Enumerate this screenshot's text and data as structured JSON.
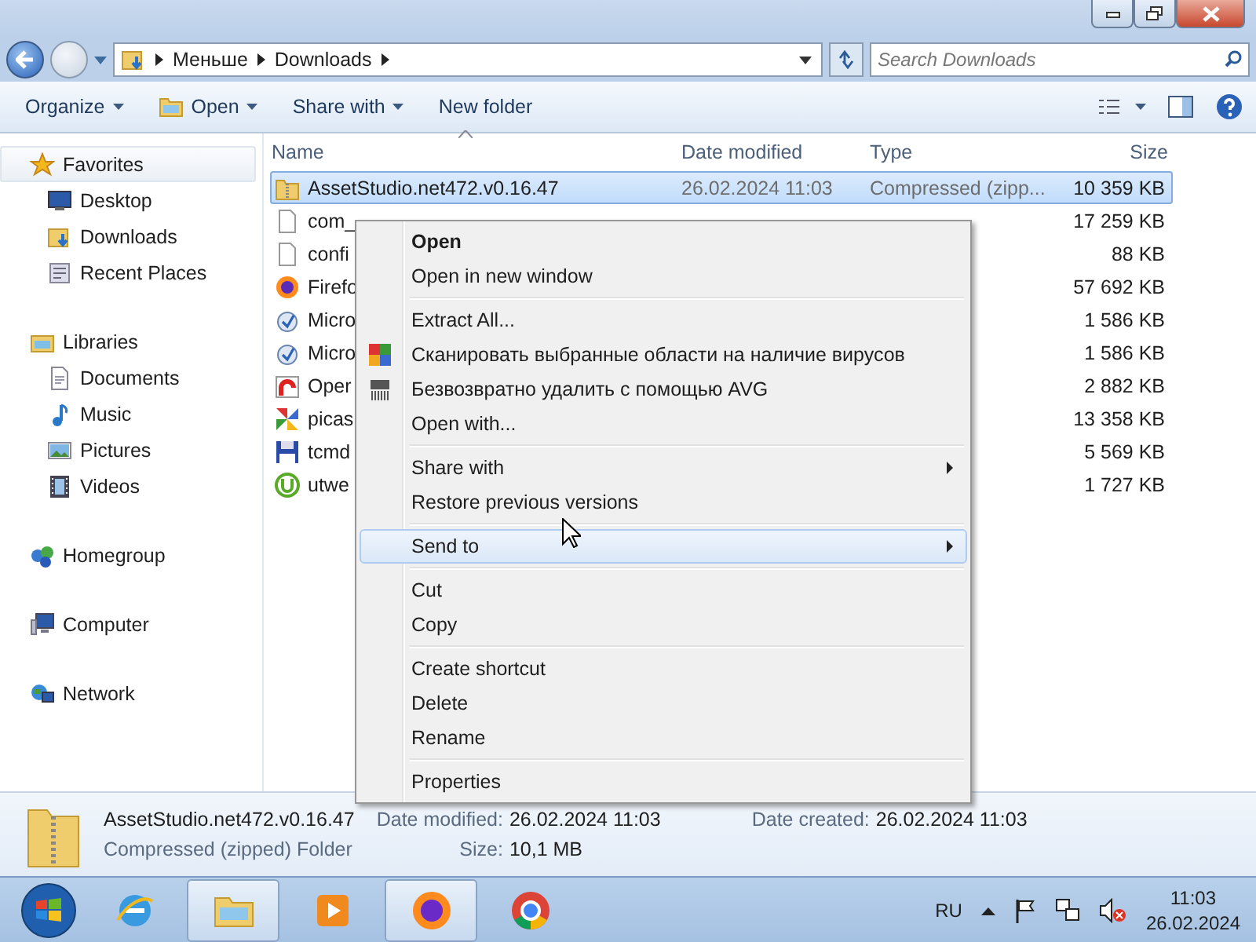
{
  "address": {
    "path": [
      "Меньше",
      "Downloads"
    ],
    "search_placeholder": "Search Downloads"
  },
  "toolbar": [
    {
      "label": "Organize",
      "dropdown": true
    },
    {
      "label": "Open",
      "dropdown": true
    },
    {
      "label": "Share with",
      "dropdown": true
    },
    {
      "label": "New folder",
      "dropdown": false
    }
  ],
  "sidebar": [
    {
      "label": "Favorites",
      "selected": true,
      "children": [
        {
          "label": "Desktop",
          "selected": false
        },
        {
          "label": "Downloads",
          "selected": false
        },
        {
          "label": "Recent Places",
          "selected": false
        }
      ]
    },
    {
      "label": "Libraries",
      "selected": false,
      "children": [
        {
          "label": "Documents",
          "selected": false
        },
        {
          "label": "Music",
          "selected": false
        },
        {
          "label": "Pictures",
          "selected": false
        },
        {
          "label": "Videos",
          "selected": false
        }
      ]
    },
    {
      "label": "Homegroup",
      "selected": false
    },
    {
      "label": "Computer",
      "selected": false
    },
    {
      "label": "Network",
      "selected": false
    }
  ],
  "columns": [
    "Name",
    "Date modified",
    "Type",
    "Size"
  ],
  "rows": [
    {
      "name": "AssetStudio.net472.v0.16.47",
      "date": "26.02.2024 11:03",
      "type": "Compressed (zipp...",
      "size": "10 359 KB",
      "selected": true
    },
    {
      "name": "com_",
      "size": "17 259 KB",
      "selected": false
    },
    {
      "name": "confi",
      "size": "88 KB",
      "selected": false
    },
    {
      "name": "Firefo",
      "size": "57 692 KB",
      "selected": false
    },
    {
      "name": "Micro",
      "size": "1 586 KB",
      "selected": false
    },
    {
      "name": "Micro",
      "size": "1 586 KB",
      "selected": false
    },
    {
      "name": "Oper",
      "size": "2 882 KB",
      "selected": false
    },
    {
      "name": "picas",
      "size": "13 358 KB",
      "selected": false
    },
    {
      "name": "tcmd",
      "size": "5 569 KB",
      "selected": false
    },
    {
      "name": "utwe",
      "size": "1 727 KB",
      "selected": false
    }
  ],
  "context_menu": [
    {
      "kind": "item",
      "label": "Open",
      "default": true,
      "selected": false
    },
    {
      "kind": "item",
      "label": "Open in new window",
      "default": false,
      "selected": false
    },
    {
      "kind": "separator"
    },
    {
      "kind": "item",
      "label": "Extract All...",
      "default": false,
      "selected": false
    },
    {
      "kind": "item",
      "label": "Сканировать выбранные области на наличие вирусов",
      "default": false,
      "selected": false
    },
    {
      "kind": "item",
      "label": "Безвозвратно удалить с помощью AVG",
      "default": false,
      "selected": false
    },
    {
      "kind": "item",
      "label": "Open with...",
      "default": false,
      "selected": false
    },
    {
      "kind": "separator"
    },
    {
      "kind": "item",
      "label": "Share with",
      "default": false,
      "selected": false,
      "submenu": true
    },
    {
      "kind": "item",
      "label": "Restore previous versions",
      "default": false,
      "selected": false
    },
    {
      "kind": "separator"
    },
    {
      "kind": "item",
      "label": "Send to",
      "default": false,
      "selected": true,
      "submenu": true
    },
    {
      "kind": "separator"
    },
    {
      "kind": "item",
      "label": "Cut",
      "default": false,
      "selected": false
    },
    {
      "kind": "item",
      "label": "Copy",
      "default": false,
      "selected": false
    },
    {
      "kind": "separator"
    },
    {
      "kind": "item",
      "label": "Create shortcut",
      "default": false,
      "selected": false
    },
    {
      "kind": "item",
      "label": "Delete",
      "default": false,
      "selected": false
    },
    {
      "kind": "item",
      "label": "Rename",
      "default": false,
      "selected": false
    },
    {
      "kind": "separator"
    },
    {
      "kind": "item",
      "label": "Properties",
      "default": false,
      "selected": false
    }
  ],
  "details": {
    "name": "AssetStudio.net472.v0.16.47",
    "type": "Compressed (zipped) Folder",
    "fields": [
      {
        "label": "Date modified:",
        "value": "26.02.2024 11:03"
      },
      {
        "label": "Size:",
        "value": "10,1 MB"
      },
      {
        "label": "Date created:",
        "value": "26.02.2024 11:03"
      }
    ]
  },
  "taskbar": {
    "apps": [
      {
        "active": false
      },
      {
        "active": true
      },
      {
        "active": false
      },
      {
        "active": true
      },
      {
        "active": false
      }
    ],
    "language": "RU",
    "time": "11:03",
    "date": "26.02.2024"
  }
}
